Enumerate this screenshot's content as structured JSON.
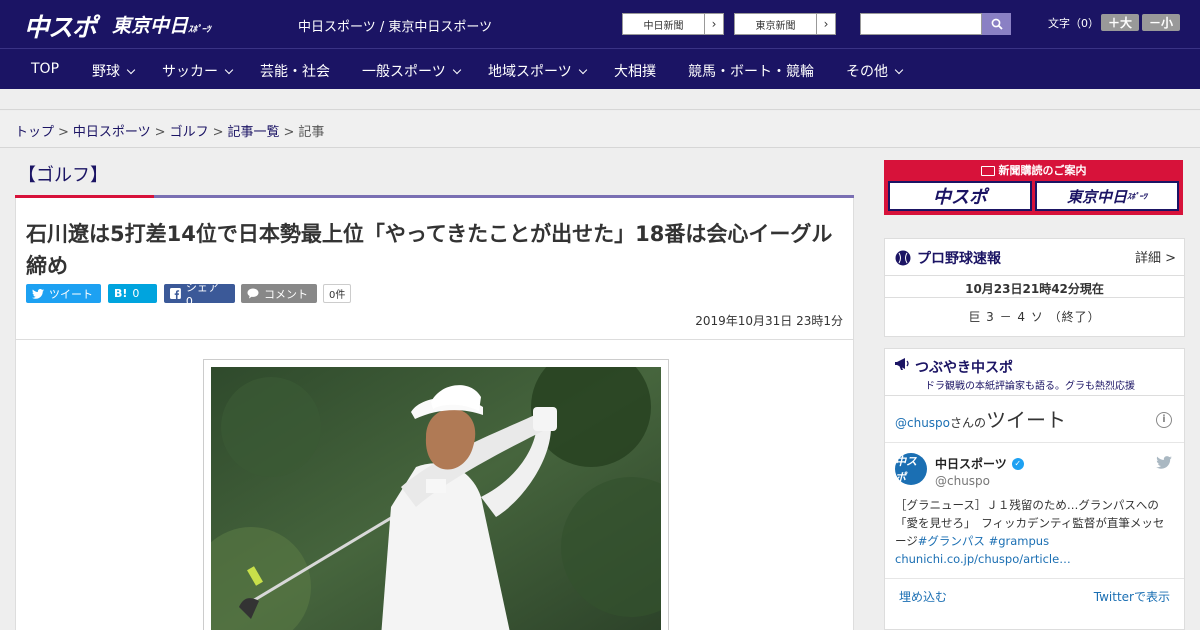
{
  "header": {
    "logo_chuspo": "中スポ",
    "logo_tokyo": "東京中日",
    "logo_tokyo_small": "ｽﾎﾟｰﾂ",
    "site_names": "中日スポーツ / 東京中日スポーツ",
    "ext_links": [
      {
        "label": "中日新聞",
        "arrow": "›"
      },
      {
        "label": "東京新聞",
        "arrow": "›"
      }
    ],
    "search_placeholder": "",
    "fontsize_label": "文字（0）",
    "fontsize_plus": "＋大",
    "fontsize_minus": "－小"
  },
  "nav": [
    {
      "label": "TOP",
      "dropdown": false
    },
    {
      "label": "野球",
      "dropdown": true
    },
    {
      "label": "サッカー",
      "dropdown": true
    },
    {
      "label": "芸能・社会",
      "dropdown": false
    },
    {
      "label": "一般スポーツ",
      "dropdown": true
    },
    {
      "label": "地域スポーツ",
      "dropdown": true
    },
    {
      "label": "大相撲",
      "dropdown": false
    },
    {
      "label": "競馬・ボート・競輪",
      "dropdown": false
    },
    {
      "label": "その他",
      "dropdown": true
    }
  ],
  "breadcrumb": {
    "items": [
      "トップ",
      "中日スポーツ",
      "ゴルフ",
      "記事一覧"
    ],
    "current": "記事",
    "separator": ">"
  },
  "article": {
    "category": "【ゴルフ】",
    "headline": "石川遼は5打差14位で日本勢最上位「やってきたことが出せた」18番は会心イーグル締め",
    "sns": {
      "tweet": "ツイート",
      "hatena_icon": "B!",
      "hatena_count": "0",
      "share": "シェア 0",
      "comment": "コメント",
      "comment_count": "0件"
    },
    "date": "2019年10月31日 23時1分"
  },
  "sidebar": {
    "ad": {
      "title": "新聞購読のご案内",
      "logo1": "中スポ",
      "logo2": "東京中日",
      "logo2_small": "ｽﾎﾟｰﾂ"
    },
    "baseball": {
      "title": "プロ野球速報",
      "detail": "詳細 >",
      "time": "10月23日21時42分現在",
      "score": "巨 3 － 4 ソ （終了）"
    },
    "tweets": {
      "title": "つぶやき中スポ",
      "subtitle": "ドラ観戦の本紙評論家も語る。グラも熱烈応援",
      "handle": "@chuspo",
      "handle_suffix": "さんの",
      "handle_big": "ツイート",
      "info": "i",
      "avatar_text": "中スポ",
      "account_name": "中日スポーツ",
      "screen_name": "@chuspo",
      "tweet_text": "［グラニュース］Ｊ１残留のため…グランパスへの「愛を見せろ」　フィッカデンティ監督が直筆メッセージ",
      "tweet_tags": "#グランパス #grampus",
      "tweet_link": "chunichi.co.jp/chuspo/article…",
      "embed": "埋め込む",
      "view_on_twitter": "Twitterで表示"
    }
  },
  "colors": {
    "brand_navy": "#1b1464",
    "accent_red": "#d7123a",
    "accent_purple": "#7a6fb3",
    "twitter_blue": "#1da1f2",
    "facebook_blue": "#3b5998",
    "hatena_blue": "#00a4de"
  }
}
